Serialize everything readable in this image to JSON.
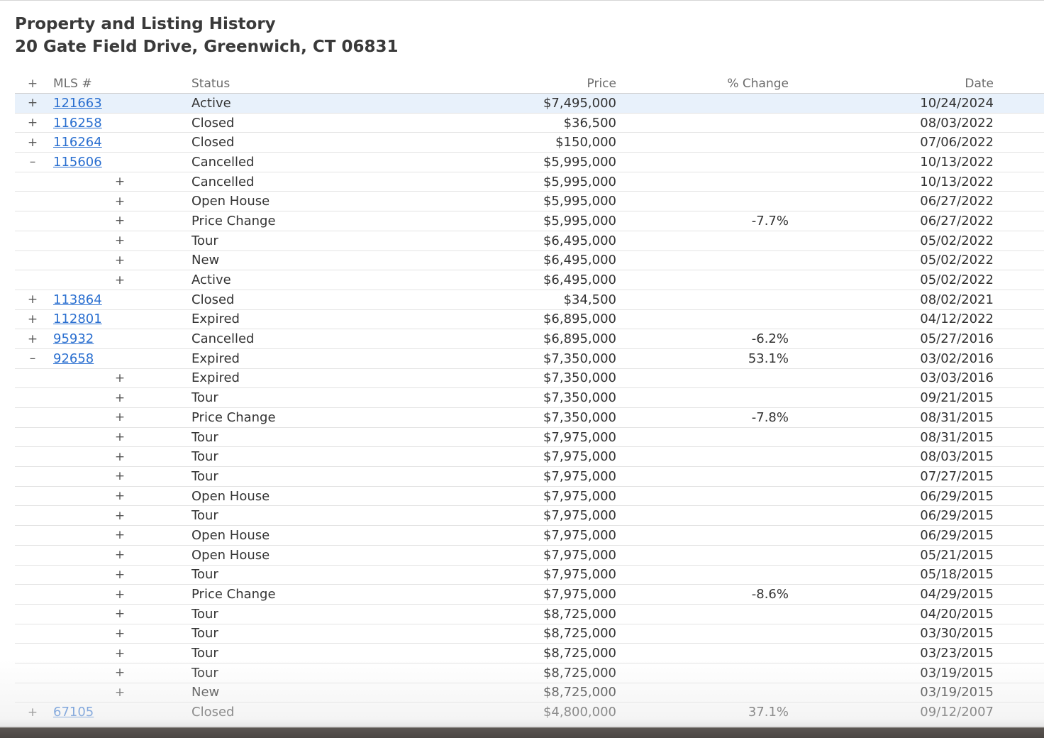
{
  "header": {
    "title": "Property and Listing History",
    "address": "20 Gate Field Drive, Greenwich, CT 06831"
  },
  "columns": {
    "toggle": "+",
    "mls": "MLS #",
    "status": "Status",
    "price": "Price",
    "change": "% Change",
    "date": "Date"
  },
  "rows": [
    {
      "toggle": "+",
      "mls": "121663",
      "sub": "",
      "status": "Active",
      "price": "$7,495,000",
      "change": "",
      "date": "10/24/2024"
    },
    {
      "toggle": "+",
      "mls": "116258",
      "sub": "",
      "status": "Closed",
      "price": "$36,500",
      "change": "",
      "date": "08/03/2022"
    },
    {
      "toggle": "+",
      "mls": "116264",
      "sub": "",
      "status": "Closed",
      "price": "$150,000",
      "change": "",
      "date": "07/06/2022"
    },
    {
      "toggle": "–",
      "mls": "115606",
      "sub": "",
      "status": "Cancelled",
      "price": "$5,995,000",
      "change": "",
      "date": "10/13/2022"
    },
    {
      "toggle": "",
      "mls": "",
      "sub": "+",
      "status": "Cancelled",
      "price": "$5,995,000",
      "change": "",
      "date": "10/13/2022"
    },
    {
      "toggle": "",
      "mls": "",
      "sub": "+",
      "status": "Open House",
      "price": "$5,995,000",
      "change": "",
      "date": "06/27/2022"
    },
    {
      "toggle": "",
      "mls": "",
      "sub": "+",
      "status": "Price Change",
      "price": "$5,995,000",
      "change": "-7.7%",
      "date": "06/27/2022"
    },
    {
      "toggle": "",
      "mls": "",
      "sub": "+",
      "status": "Tour",
      "price": "$6,495,000",
      "change": "",
      "date": "05/02/2022"
    },
    {
      "toggle": "",
      "mls": "",
      "sub": "+",
      "status": "New",
      "price": "$6,495,000",
      "change": "",
      "date": "05/02/2022"
    },
    {
      "toggle": "",
      "mls": "",
      "sub": "+",
      "status": "Active",
      "price": "$6,495,000",
      "change": "",
      "date": "05/02/2022"
    },
    {
      "toggle": "+",
      "mls": "113864",
      "sub": "",
      "status": "Closed",
      "price": "$34,500",
      "change": "",
      "date": "08/02/2021"
    },
    {
      "toggle": "+",
      "mls": "112801",
      "sub": "",
      "status": "Expired",
      "price": "$6,895,000",
      "change": "",
      "date": "04/12/2022"
    },
    {
      "toggle": "+",
      "mls": "95932",
      "sub": "",
      "status": "Cancelled",
      "price": "$6,895,000",
      "change": "-6.2%",
      "date": "05/27/2016"
    },
    {
      "toggle": "–",
      "mls": "92658",
      "sub": "",
      "status": "Expired",
      "price": "$7,350,000",
      "change": "53.1%",
      "date": "03/02/2016"
    },
    {
      "toggle": "",
      "mls": "",
      "sub": "+",
      "status": "Expired",
      "price": "$7,350,000",
      "change": "",
      "date": "03/03/2016"
    },
    {
      "toggle": "",
      "mls": "",
      "sub": "+",
      "status": "Tour",
      "price": "$7,350,000",
      "change": "",
      "date": "09/21/2015"
    },
    {
      "toggle": "",
      "mls": "",
      "sub": "+",
      "status": "Price Change",
      "price": "$7,350,000",
      "change": "-7.8%",
      "date": "08/31/2015"
    },
    {
      "toggle": "",
      "mls": "",
      "sub": "+",
      "status": "Tour",
      "price": "$7,975,000",
      "change": "",
      "date": "08/31/2015"
    },
    {
      "toggle": "",
      "mls": "",
      "sub": "+",
      "status": "Tour",
      "price": "$7,975,000",
      "change": "",
      "date": "08/03/2015"
    },
    {
      "toggle": "",
      "mls": "",
      "sub": "+",
      "status": "Tour",
      "price": "$7,975,000",
      "change": "",
      "date": "07/27/2015"
    },
    {
      "toggle": "",
      "mls": "",
      "sub": "+",
      "status": "Open House",
      "price": "$7,975,000",
      "change": "",
      "date": "06/29/2015"
    },
    {
      "toggle": "",
      "mls": "",
      "sub": "+",
      "status": "Tour",
      "price": "$7,975,000",
      "change": "",
      "date": "06/29/2015"
    },
    {
      "toggle": "",
      "mls": "",
      "sub": "+",
      "status": "Open House",
      "price": "$7,975,000",
      "change": "",
      "date": "06/29/2015"
    },
    {
      "toggle": "",
      "mls": "",
      "sub": "+",
      "status": "Open House",
      "price": "$7,975,000",
      "change": "",
      "date": "05/21/2015"
    },
    {
      "toggle": "",
      "mls": "",
      "sub": "+",
      "status": "Tour",
      "price": "$7,975,000",
      "change": "",
      "date": "05/18/2015"
    },
    {
      "toggle": "",
      "mls": "",
      "sub": "+",
      "status": "Price Change",
      "price": "$7,975,000",
      "change": "-8.6%",
      "date": "04/29/2015"
    },
    {
      "toggle": "",
      "mls": "",
      "sub": "+",
      "status": "Tour",
      "price": "$8,725,000",
      "change": "",
      "date": "04/20/2015"
    },
    {
      "toggle": "",
      "mls": "",
      "sub": "+",
      "status": "Tour",
      "price": "$8,725,000",
      "change": "",
      "date": "03/30/2015"
    },
    {
      "toggle": "",
      "mls": "",
      "sub": "+",
      "status": "Tour",
      "price": "$8,725,000",
      "change": "",
      "date": "03/23/2015"
    },
    {
      "toggle": "",
      "mls": "",
      "sub": "+",
      "status": "Tour",
      "price": "$8,725,000",
      "change": "",
      "date": "03/19/2015"
    },
    {
      "toggle": "",
      "mls": "",
      "sub": "+",
      "status": "New",
      "price": "$8,725,000",
      "change": "",
      "date": "03/19/2015"
    },
    {
      "toggle": "+",
      "mls": "67105",
      "sub": "",
      "status": "Closed",
      "price": "$4,800,000",
      "change": "37.1%",
      "date": "09/12/2007"
    }
  ],
  "highlighted_row": 0,
  "colors": {
    "link": "#2a6fd0",
    "highlight": "#e8f1fb",
    "text": "#333333"
  }
}
